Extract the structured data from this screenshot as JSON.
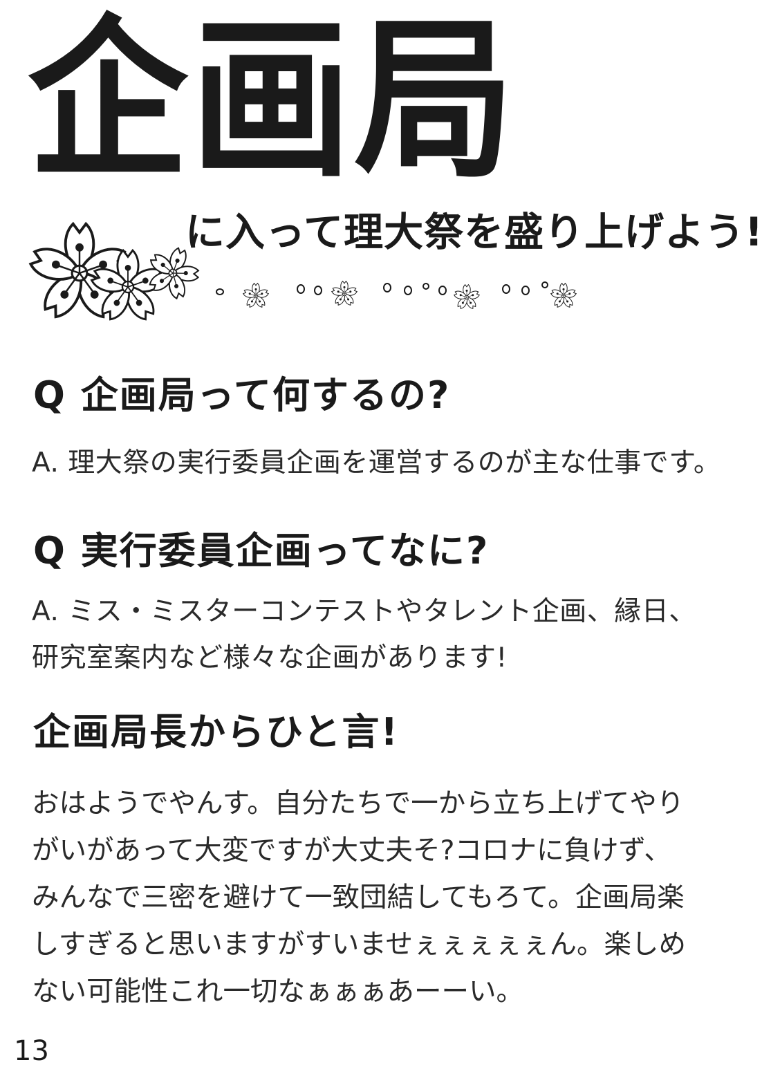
{
  "title": "企画局",
  "subtitle": "に入って理大祭を盛り上げよう!",
  "qa": [
    {
      "question": "Q 企画局って何するの?",
      "answer_lines": [
        "A. 理大祭の実行委員企画を運営するのが主な仕事です。"
      ]
    },
    {
      "question": "Q 実行委員企画ってなに?",
      "answer_lines": [
        "A. ミス・ミスターコンテストやタレント企画、縁日、",
        "研究室案内など様々な企画があります!"
      ]
    }
  ],
  "message": {
    "heading": "企画局長からひと言!",
    "lines": [
      "おはようでやんす。自分たちで一から立ち上げてやり",
      "がいがあって大変ですが大丈夫そ?コロナに負けず、",
      "みんなで三密を避けて一致団結してもろて。企画局楽",
      "しすぎると思いますがすいませぇぇぇぇぇん。楽しめ",
      "ない可能性これ一切なぁぁぁあーーい。"
    ]
  },
  "page_number": "13",
  "decoration": "cherry-blossom-icon"
}
